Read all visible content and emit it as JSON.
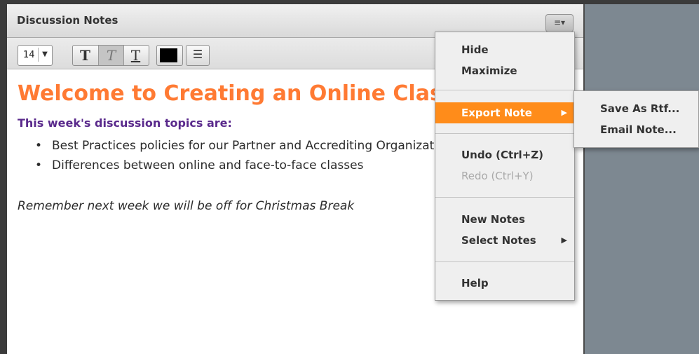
{
  "pod": {
    "title": "Discussion Notes",
    "menu_button_icon": "≡▾"
  },
  "toolbar": {
    "font_size": "14",
    "font_size_arrow": "▼",
    "bold_label": "T",
    "italic_label": "T",
    "underline_label": "T",
    "text_color": "#000000",
    "list_icon": "☰"
  },
  "note": {
    "heading": "Welcome to Creating an Online Class",
    "subheading": "This week's discussion topics are:",
    "bullets": [
      "Best Practices policies for our Partner and Accrediting Organizations",
      "Differences between online and face-to-face classes"
    ],
    "reminder": "Remember next week we will be off for Christmas Break"
  },
  "menu": {
    "hide": "Hide",
    "maximize": "Maximize",
    "export_note": "Export Note",
    "undo": "Undo (Ctrl+Z)",
    "redo": "Redo (Ctrl+Y)",
    "new_notes": "New Notes",
    "select_notes": "Select Notes",
    "help": "Help",
    "submenu_arrow": "▶"
  },
  "submenu": {
    "save_as_rtf": "Save As Rtf...",
    "email_note": "Email Note..."
  },
  "colors": {
    "heading": "#ff7a33",
    "subheading": "#5a2a8c",
    "menu_highlight": "#ff8c1a",
    "background_right": "#7d8891"
  }
}
